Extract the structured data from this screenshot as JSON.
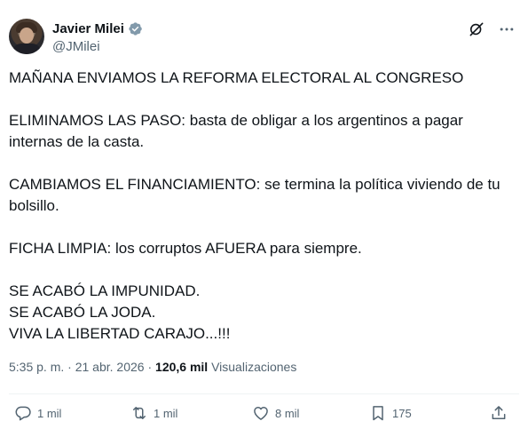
{
  "author": {
    "display_name": "Javier Milei",
    "handle": "@JMilei"
  },
  "body": {
    "line1": "MAÑANA ENVIAMOS LA REFORMA ELECTORAL AL CONGRESO",
    "line2a": "ELIMINAMOS LAS PASO: basta de obligar a los argentinos a pagar",
    "line2b": "internas de la casta.",
    "line3a": "CAMBIAMOS EL FINANCIAMIENTO: se termina la política viviendo de tu",
    "line3b": "bolsillo.",
    "line4": "FICHA LIMPIA: los corruptos AFUERA para siempre.",
    "line5": "SE ACABÓ LA IMPUNIDAD.",
    "line6": "SE ACABÓ LA JODA.",
    "line7": "VIVA LA LIBERTAD CARAJO...!!!"
  },
  "meta": {
    "time": "5:35 p. m.",
    "separator1": " · ",
    "date": "21 abr. 2026",
    "separator2": " · ",
    "views_count": "120,6 mil",
    "views_label": " Visualizaciones"
  },
  "actions": {
    "replies": "1 mil",
    "retweets": "1 mil",
    "likes": "8 mil",
    "bookmarks": "175"
  },
  "colors": {
    "text": "#0f1419",
    "secondary": "#536471",
    "verified": "#829aab"
  },
  "icons": [
    "verified-badge-icon",
    "grok-icon",
    "more-icon",
    "reply-icon",
    "retweet-icon",
    "like-icon",
    "bookmark-icon",
    "share-icon"
  ]
}
